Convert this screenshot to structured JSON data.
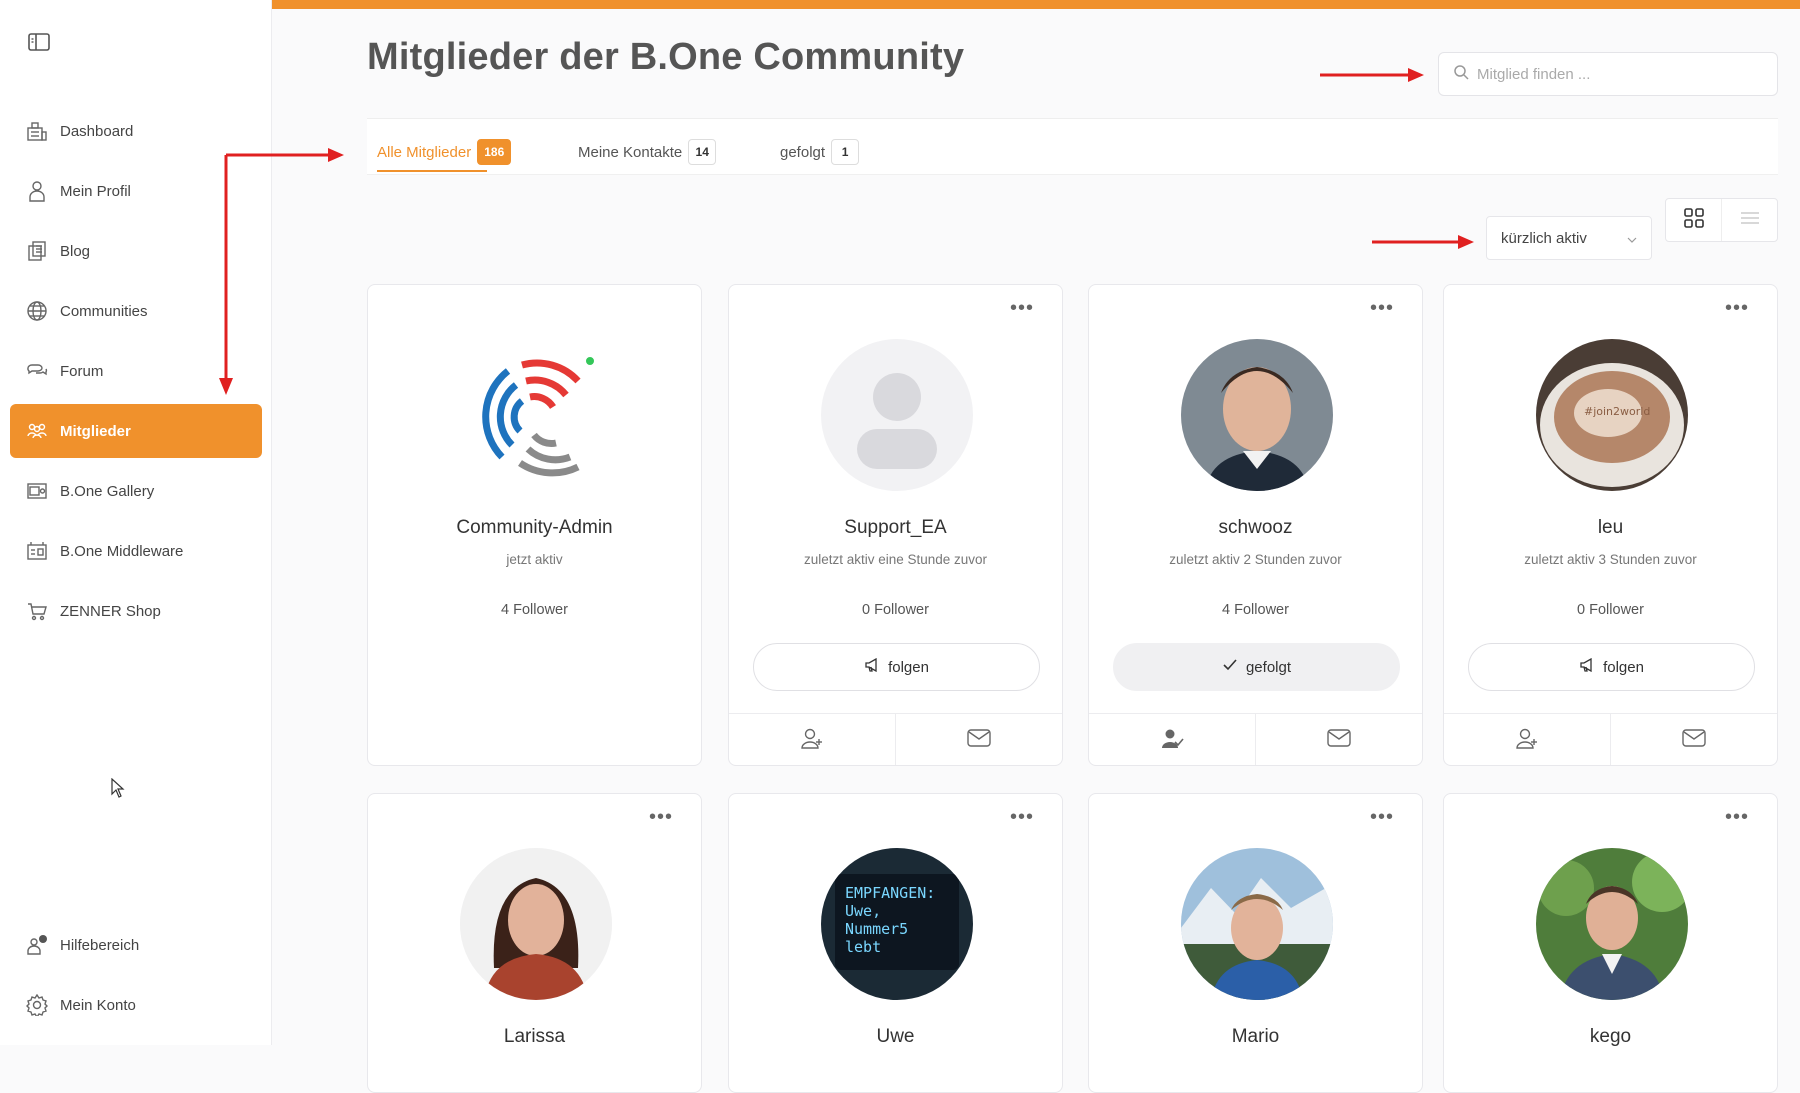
{
  "page": {
    "title": "Mitglieder der B.One Community"
  },
  "search": {
    "placeholder": "Mitglied finden ..."
  },
  "sidebar": {
    "items": [
      {
        "label": "Dashboard",
        "icon": "dashboard-icon"
      },
      {
        "label": "Mein Profil",
        "icon": "profile-icon"
      },
      {
        "label": "Blog",
        "icon": "blog-icon"
      },
      {
        "label": "Communities",
        "icon": "globe-icon"
      },
      {
        "label": "Forum",
        "icon": "forum-icon"
      },
      {
        "label": "Mitglieder",
        "icon": "members-icon",
        "active": true
      },
      {
        "label": "B.One Gallery",
        "icon": "gallery-icon"
      },
      {
        "label": "B.One Middleware",
        "icon": "middleware-icon"
      },
      {
        "label": "ZENNER Shop",
        "icon": "cart-icon"
      }
    ],
    "bottom": [
      {
        "label": "Hilfebereich",
        "icon": "help-icon"
      },
      {
        "label": "Mein Konto",
        "icon": "gear-icon"
      }
    ]
  },
  "tabs": [
    {
      "label": "Alle Mitglieder",
      "count": "186",
      "active": true
    },
    {
      "label": "Meine Kontakte",
      "count": "14"
    },
    {
      "label": "gefolgt",
      "count": "1"
    }
  ],
  "sort": {
    "selected": "kürzlich aktiv"
  },
  "colors": {
    "accent": "#f0912c",
    "online": "#34c759",
    "arrow": "#e02020"
  },
  "members": [
    {
      "name": "Community-Admin",
      "status": "jetzt aktiv",
      "followers": "4 Follower",
      "avatar": "community-logo"
    },
    {
      "name": "Support_EA",
      "status": "zuletzt aktiv eine Stunde zuvor",
      "followers": "0 Follower",
      "button": "folgen",
      "avatar": "placeholder"
    },
    {
      "name": "schwooz",
      "status": "zuletzt aktiv 2 Stunden zuvor",
      "followers": "4 Follower",
      "button": "gefolgt",
      "avatar": "photo"
    },
    {
      "name": "leu",
      "status": "zuletzt aktiv 3 Stunden zuvor",
      "followers": "0 Follower",
      "button": "folgen",
      "avatar": "photo"
    },
    {
      "name": "Larissa",
      "avatar": "photo"
    },
    {
      "name": "Uwe",
      "avatar": "photo",
      "display_text": [
        "EMPFANGEN:",
        "Uwe,",
        "Nummer5",
        "lebt"
      ]
    },
    {
      "name": "Mario",
      "avatar": "photo"
    },
    {
      "name": "kego",
      "avatar": "photo"
    }
  ]
}
